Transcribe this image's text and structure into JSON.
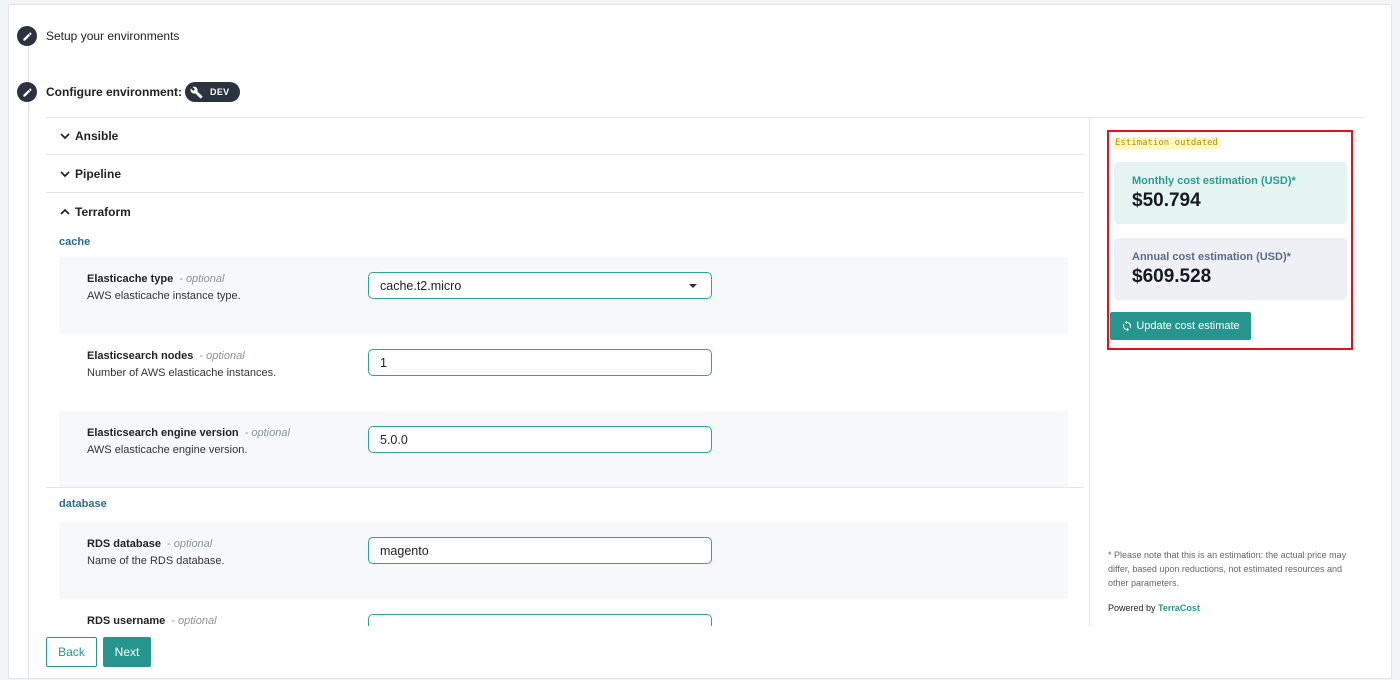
{
  "steps": {
    "setup_label": "Setup your environments",
    "configure_label": "Configure environment:",
    "env_badge": "DEV"
  },
  "sections": {
    "ansible": "Ansible",
    "pipeline": "Pipeline",
    "terraform": "Terraform"
  },
  "groups": {
    "cache": "cache",
    "database": "database"
  },
  "fields": {
    "elasticache_type": {
      "label": "Elasticache type",
      "optional": "- optional",
      "desc": "AWS elasticache instance type.",
      "value": "cache.t2.micro"
    },
    "elasticsearch_nodes": {
      "label": "Elasticsearch nodes",
      "optional": "- optional",
      "desc": "Number of AWS elasticache instances.",
      "value": "1"
    },
    "elasticsearch_engine_version": {
      "label": "Elasticsearch engine version",
      "optional": "- optional",
      "desc": "AWS elasticache engine version.",
      "value": "5.0.0"
    },
    "rds_database": {
      "label": "RDS database",
      "optional": "- optional",
      "desc": "Name of the RDS database.",
      "value": "magento"
    },
    "rds_username": {
      "label": "RDS username",
      "optional": "- optional"
    }
  },
  "estimate": {
    "outdated": "Estimation outdated",
    "monthly_title": "Monthly cost estimation (USD)*",
    "monthly_value": "$50.794",
    "annual_title": "Annual cost estimation (USD)*",
    "annual_value": "$609.528",
    "update_button": "Update cost estimate",
    "note": "* Please note that this is an estimation: the actual price may differ, based upon reductions, not estimated resources and other parameters.",
    "powered_prefix": "Powered by",
    "powered_brand": "TerraCost"
  },
  "footer": {
    "back": "Back",
    "next": "Next"
  },
  "colors": {
    "accent": "#26958d",
    "highlight_border": "#e3101d",
    "dark": "#2b3340"
  },
  "icons": {
    "step": "pencil-icon",
    "badge": "wrench-icon",
    "expand": "chevron-down-icon",
    "collapse": "chevron-up-icon",
    "refresh": "refresh-icon"
  }
}
